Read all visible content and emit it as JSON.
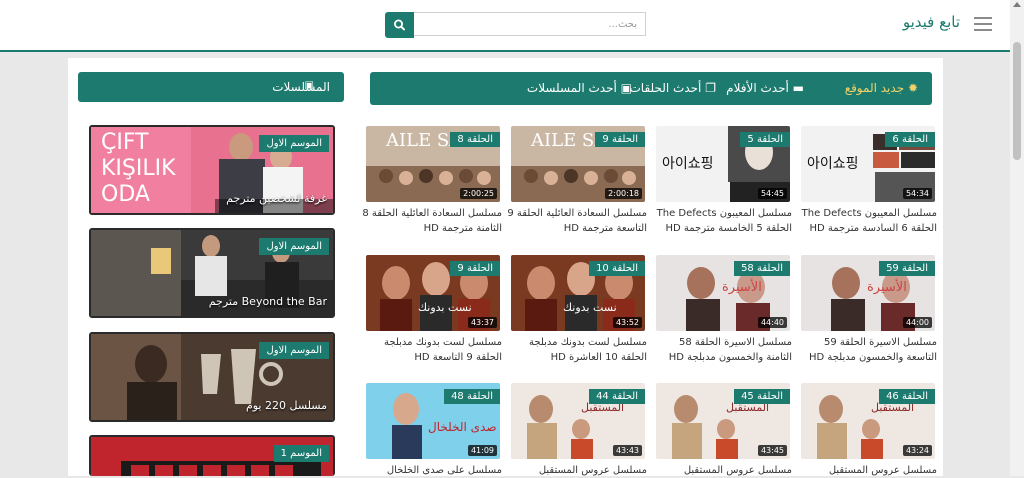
{
  "header": {
    "brand": "تابع فيديو",
    "search_placeholder": "بحث..."
  },
  "colors": {
    "accent": "#1c7a6e",
    "highlight": "#f2d36b"
  },
  "sidebar": {
    "title": "المسلسلات",
    "icon": "tv-icon",
    "items": [
      {
        "badge": "الموسم الاول",
        "title": "غرفة لشخصين مترجم"
      },
      {
        "badge": "الموسم الاول",
        "title": "Beyond the Bar مترجم"
      },
      {
        "badge": "الموسم الاول",
        "title": "مسلسل 220 يوم"
      },
      {
        "badge": "الموسم 1",
        "title": ""
      }
    ]
  },
  "main_nav": {
    "new": "جديد الموقع",
    "movies": "أحدث الأفلام",
    "episodes": "أحدث الحلقات",
    "series": "أحدث المسلسلات"
  },
  "thumb_overlays": {
    "aile": "AILE SAADE",
    "korean": "아이쇼핑",
    "naseeb": "نست بدونك",
    "aseera": "الأسيرة",
    "future": "المستقبل",
    "echo": "على صدى الخلخال",
    "cift": [
      "ÇIFT",
      "KIŞILIK",
      "ODA"
    ]
  },
  "grid": [
    [
      {
        "badge": "الحلقة 6",
        "duration": "54:34",
        "title": "مسلسل المعيبون The Defects الحلقة 6 السادسة مترجمة HD"
      },
      {
        "badge": "الحلقة 5",
        "duration": "54:45",
        "title": "مسلسل المعيبون The Defects الحلقة 5 الخامسة مترجمة HD"
      },
      {
        "badge": "الحلقة 9",
        "duration": "2:00:18",
        "title": "مسلسل السعادة العائلية الحلقة 9 التاسعة مترجمة HD"
      },
      {
        "badge": "الحلقة 8",
        "duration": "2:00:25",
        "title": "مسلسل السعادة العائلية الحلقة 8 الثامنة مترجمة HD"
      }
    ],
    [
      {
        "badge": "الحلقة 59",
        "duration": "44:00",
        "title": "مسلسل الاسيرة الحلقة 59 التاسعة والخمسون مدبلجة HD"
      },
      {
        "badge": "الحلقة 58",
        "duration": "44:40",
        "title": "مسلسل الاسيرة الحلقة 58 الثامنة والخمسون مدبلجة HD"
      },
      {
        "badge": "الحلقة 10",
        "duration": "43:52",
        "title": "مسلسل لست بدونك مدبلجة الحلقة 10 العاشرة HD"
      },
      {
        "badge": "الحلقة 9",
        "duration": "43:37",
        "title": "مسلسل لست بدونك مدبلجة الحلقة 9 التاسعة HD"
      }
    ],
    [
      {
        "badge": "الحلقة 46",
        "duration": "43:24",
        "title": "مسلسل عروس المستقبل"
      },
      {
        "badge": "الحلقة 45",
        "duration": "43:45",
        "title": "مسلسل عروس المستقبل"
      },
      {
        "badge": "الحلقة 44",
        "duration": "43:43",
        "title": "مسلسل عروس المستقبل"
      },
      {
        "badge": "الحلقة 48",
        "duration": "41:09",
        "title": "مسلسل على صدى الخلخال"
      }
    ]
  ]
}
